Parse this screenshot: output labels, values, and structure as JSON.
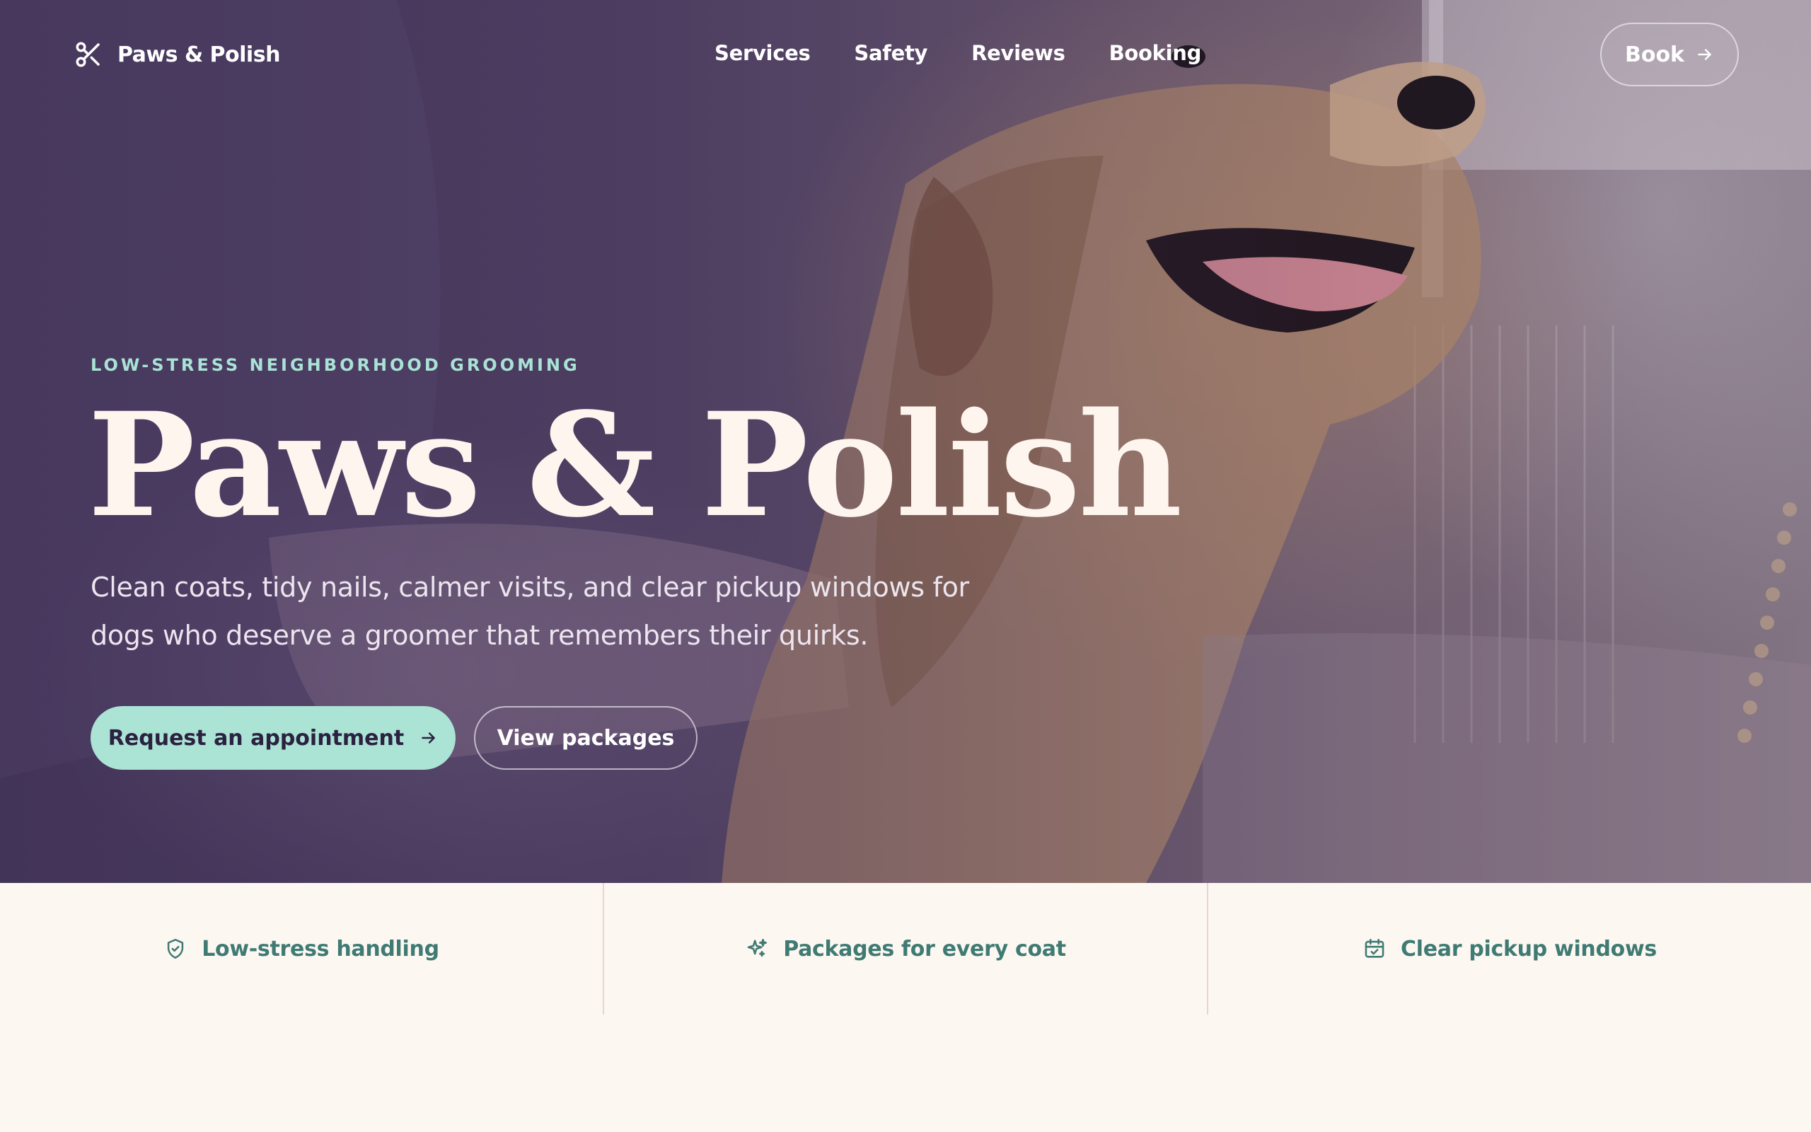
{
  "brand": {
    "name": "Paws & Polish",
    "icon": "scissors-icon"
  },
  "nav": {
    "links": [
      "Services",
      "Safety",
      "Reviews",
      "Booking"
    ],
    "book_label": "Book"
  },
  "hero": {
    "eyebrow": "LOW-STRESS NEIGHBORHOOD GROOMING",
    "title": "Paws & Polish",
    "subtitle": "Clean coats, tidy nails, calmer visits, and clear pickup windows for dogs who deserve a groomer that remembers their quirks.",
    "primary_cta": "Request an appointment",
    "secondary_cta": "View packages"
  },
  "features": [
    {
      "label": "Low-stress handling",
      "icon": "shield-check-icon"
    },
    {
      "label": "Packages for every coat",
      "icon": "sparkles-icon"
    },
    {
      "label": "Clear pickup windows",
      "icon": "calendar-check-icon"
    }
  ],
  "colors": {
    "accent": "#abe3d5",
    "feature_text": "#3f7b73",
    "page_bg": "#fdf7f2",
    "hero_overlay": "#4a3b5c"
  }
}
